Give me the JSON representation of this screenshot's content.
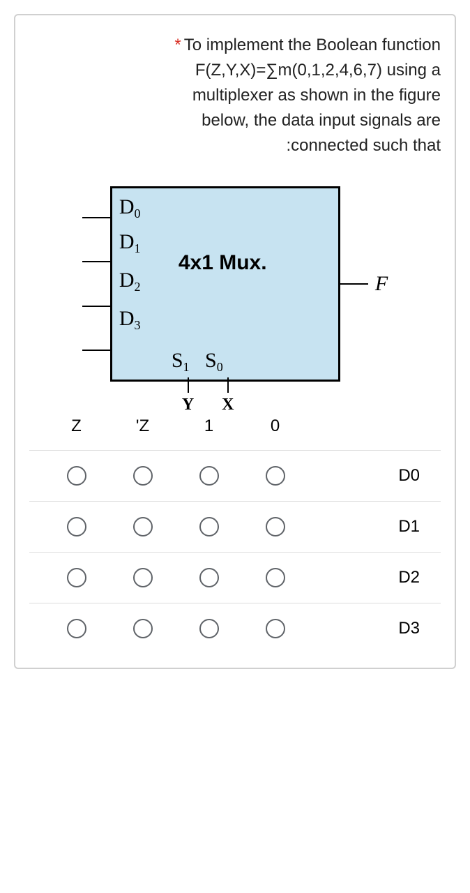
{
  "question": {
    "line1": "To implement the Boolean function",
    "line2": "F(Z,Y,X)=∑m(0,1,2,4,6,7) using a",
    "line3": "multiplexer as shown in the figure",
    "line4": "below, the  data input signals are",
    "line5": ":connected such that"
  },
  "mux": {
    "title": "4x1 Mux.",
    "d0": "D",
    "d0_sub": "0",
    "d1": "D",
    "d1_sub": "1",
    "d2": "D",
    "d2_sub": "2",
    "d3": "D",
    "d3_sub": "3",
    "s1": "S",
    "s1_sub": "1",
    "s0": "S",
    "s0_sub": "0",
    "output": "F",
    "sel_y": "Y",
    "sel_x": "X"
  },
  "columns": {
    "c0": "Z",
    "c1": "'Z",
    "c2": "1",
    "c3": "0"
  },
  "rows": {
    "r0": "D0",
    "r1": "D1",
    "r2": "D2",
    "r3": "D3"
  }
}
